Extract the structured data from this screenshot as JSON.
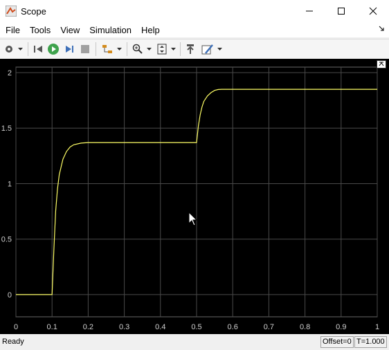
{
  "window": {
    "title": "Scope"
  },
  "menu": [
    "File",
    "Tools",
    "View",
    "Simulation",
    "Help"
  ],
  "toolbar": {
    "buttons": [
      "settings-icon",
      "step-back-icon",
      "run-icon",
      "step-forward-icon",
      "stop-icon",
      "highlight-icon",
      "zoom-in-icon",
      "fit-axes-icon",
      "restore-icon",
      "style-icon"
    ]
  },
  "status": {
    "text": "Ready",
    "offset": "Offset=0",
    "time": "T=1.000"
  },
  "chart_data": {
    "type": "line",
    "xlim": [
      0,
      1
    ],
    "ylim": [
      -0.2,
      2.05
    ],
    "xticks": [
      "0",
      "0.1",
      "0.2",
      "0.3",
      "0.4",
      "0.5",
      "0.6",
      "0.7",
      "0.8",
      "0.9",
      "1"
    ],
    "yticks": [
      "0",
      "0.5",
      "1",
      "1.5",
      "2"
    ],
    "grid": true,
    "series": [
      {
        "color": "#ffff66",
        "x": [
          0,
          0.1,
          0.105,
          0.11,
          0.115,
          0.12,
          0.13,
          0.14,
          0.15,
          0.16,
          0.18,
          0.2,
          0.25,
          0.3,
          0.4,
          0.5,
          0.505,
          0.51,
          0.515,
          0.52,
          0.53,
          0.54,
          0.55,
          0.56,
          0.57,
          0.6,
          0.7,
          0.8,
          0.9,
          1.0
        ],
        "y": [
          0,
          0,
          0.4,
          0.75,
          0.95,
          1.08,
          1.22,
          1.29,
          1.33,
          1.35,
          1.365,
          1.37,
          1.37,
          1.37,
          1.37,
          1.37,
          1.52,
          1.62,
          1.69,
          1.74,
          1.79,
          1.82,
          1.84,
          1.848,
          1.85,
          1.85,
          1.85,
          1.85,
          1.85,
          1.85
        ]
      }
    ]
  }
}
